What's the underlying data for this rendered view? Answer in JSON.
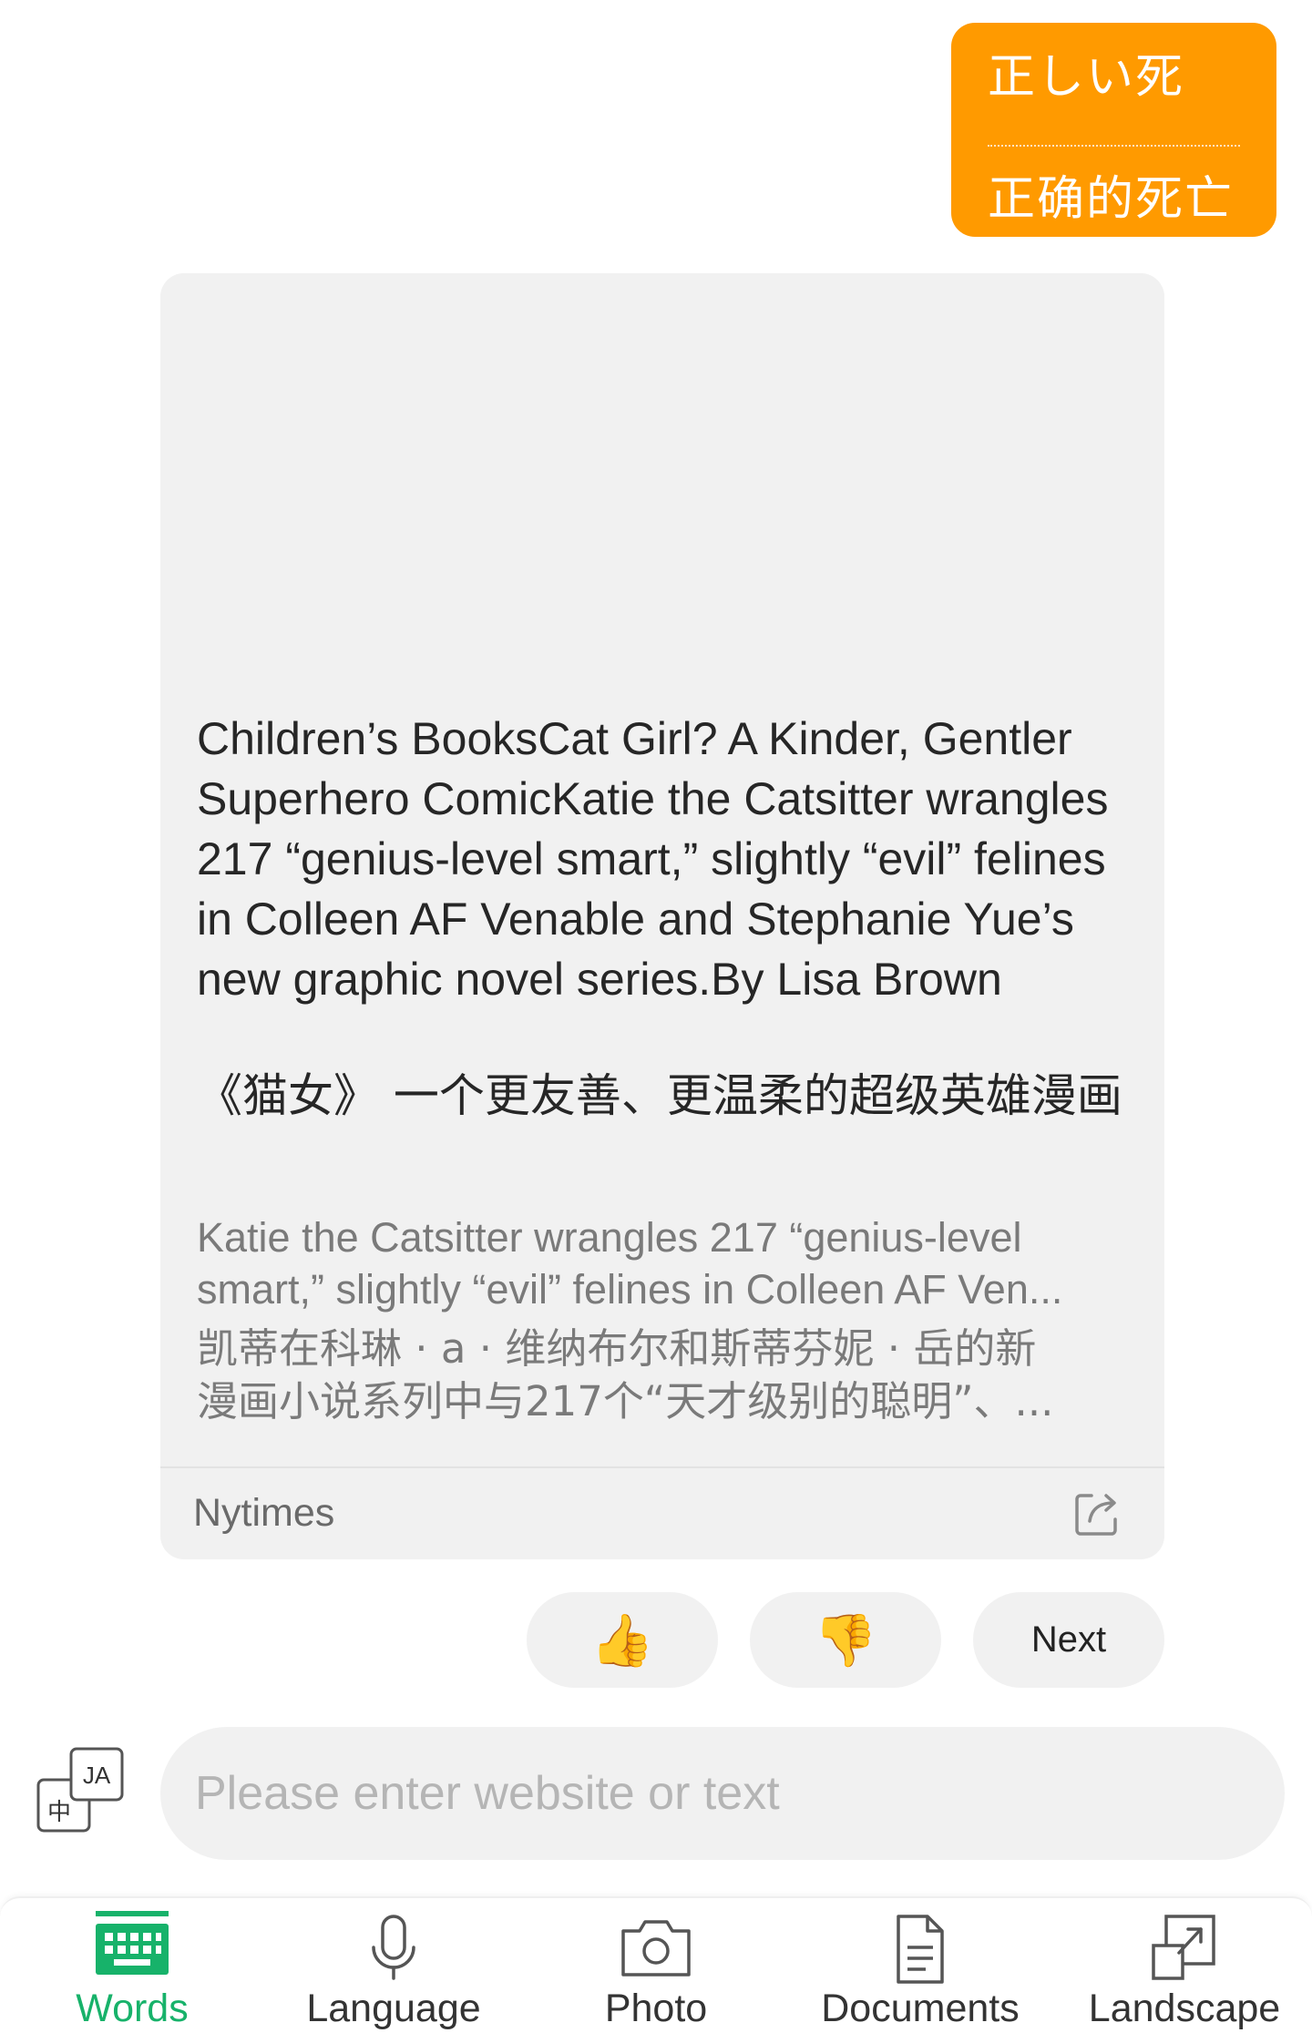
{
  "translation_bubble": {
    "source_text": "正しい死",
    "translated_text": "正确的死亡"
  },
  "article": {
    "title": "Children’s BooksCat Girl? A Kinder, Gentler Superhero ComicKatie the Catsitter wrangles 217 “genius-level smart,” slightly “evil” felines in Colleen AF Venable and Stephanie Yue’s new graphic novel series.By Lisa Brown",
    "title_translated": "《猫女》 一个更友善、更温柔的超级英雄漫画",
    "summary_lines": [
      "Katie the Catsitter wrangles 217 “genius-level",
      "smart,” slightly “evil” felines in Colleen AF Ven..."
    ],
    "summary_translated_lines": [
      "凯蒂在科琳 · a · 维纳布尔和斯蒂芬妮 · 岳的新",
      "漫画小说系列中与217个“天才级别的聪明”、..."
    ],
    "source": "Nytimes",
    "share_icon": "share-icon"
  },
  "feedback": {
    "like_icon": "👍",
    "dislike_icon": "👎",
    "next_label": "Next"
  },
  "input": {
    "placeholder": "Please enter website or text",
    "lang_switch_from": "中",
    "lang_switch_to": "JA"
  },
  "tabs": [
    {
      "label": "Words",
      "icon": "keyboard-icon",
      "active": true
    },
    {
      "label": "Language",
      "icon": "microphone-icon",
      "active": false
    },
    {
      "label": "Photo",
      "icon": "camera-icon",
      "active": false
    },
    {
      "label": "Documents",
      "icon": "document-icon",
      "active": false
    },
    {
      "label": "Landscape",
      "icon": "landscape-icon",
      "active": false
    }
  ],
  "colors": {
    "accent_orange": "#ff9a00",
    "active_green": "#17b26a",
    "card_bg": "#f1f1f1"
  }
}
